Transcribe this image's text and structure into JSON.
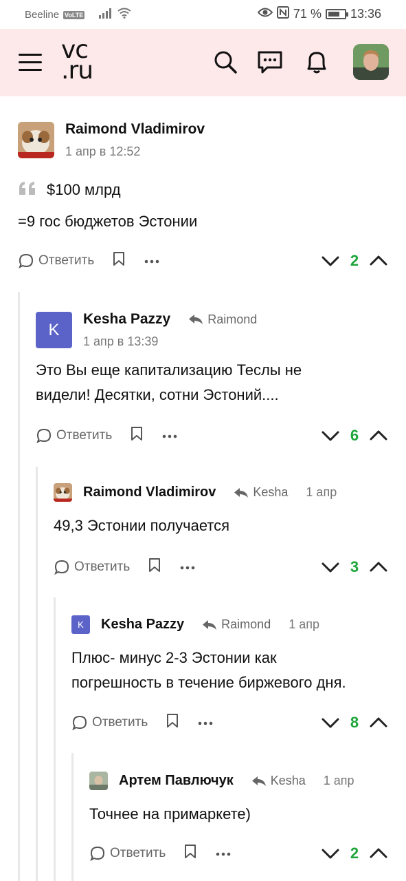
{
  "status_bar": {
    "carrier": "Beeline",
    "volte": "VoLTE",
    "battery_percent": "71 %",
    "battery_level": 0.71,
    "time": "13:36"
  },
  "header": {
    "logo_line1": "vc",
    "logo_line2": ".ru",
    "icons": [
      "menu-icon",
      "search-icon",
      "messages-icon",
      "bell-icon"
    ]
  },
  "actions": {
    "reply_label": "Ответить"
  },
  "colors": {
    "header_bg": "#fde8ea",
    "vote_positive": "#1da53a",
    "letter_avatar": "#5b63c8"
  },
  "comments": [
    {
      "author": "Raimond Vladimirov",
      "date": "1 апр в 12:52",
      "quote": "$100 млрд",
      "text": "=9 гос бюджетов Эстонии",
      "votes": "2"
    },
    {
      "author": "Kesha Pazzy",
      "avatar_letter": "K",
      "reply_to": "Raimond",
      "date": "1 апр в 13:39",
      "text_line1": "Это Вы еще капитализацию Теслы не",
      "text_line2": "видели! Десятки, сотни Эстоний....",
      "votes": "6"
    },
    {
      "author": "Raimond Vladimirov",
      "reply_to": "Kesha",
      "date": "1 апр",
      "text": "49,3 Эстонии получается",
      "votes": "3"
    },
    {
      "author": "Kesha Pazzy",
      "avatar_letter": "K",
      "reply_to": "Raimond",
      "date": "1 апр",
      "text_line1": "Плюс- минус 2-3 Эстонии как",
      "text_line2": "погрешность в течение биржевого дня.",
      "votes": "8"
    },
    {
      "author": "Артем Павлючук",
      "reply_to": "Kesha",
      "date": "1 апр",
      "text": "Точнее на примаркете)",
      "votes": "2"
    }
  ]
}
